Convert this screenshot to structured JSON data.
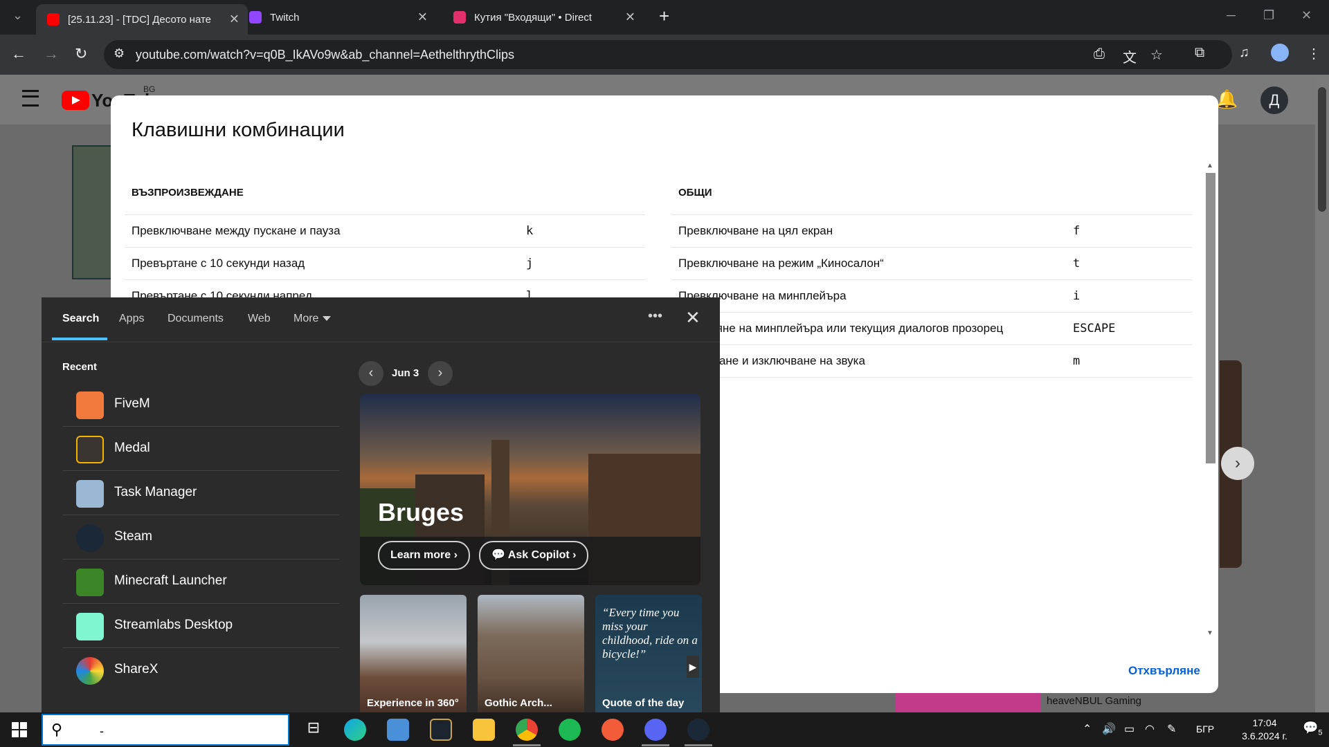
{
  "browser": {
    "tabs": [
      {
        "title": "[25.11.23] - [TDC] Десото нате",
        "color": "#ff0000"
      },
      {
        "title": "Twitch",
        "color": "#9146ff"
      },
      {
        "title": "Кутия \"Входящи\" • Direct",
        "color": "#e1306c"
      }
    ],
    "new_tab": "+",
    "url": "youtube.com/watch?v=q0B_IkAVo9w&ab_channel=AethelthrythClips"
  },
  "youtube": {
    "logo_text": "YouTube",
    "region": "BG",
    "avatar_letter": "Д",
    "channel_name": "heaveNBUL Gaming"
  },
  "shortcuts": {
    "title": "Клавишни комбинации",
    "playback": {
      "heading": "ВЪЗПРОИЗВЕЖДАНЕ",
      "rows": [
        {
          "label": "Превключване между пускане и пауза",
          "key": "k"
        },
        {
          "label": "Превъртане с 10 секунди назад",
          "key": "j"
        },
        {
          "label": "Превъртане с 10 секунди напред",
          "key": "l"
        }
      ]
    },
    "general": {
      "heading": "ОБЩИ",
      "rows": [
        {
          "label": "Превключване на цял екран",
          "key": "f"
        },
        {
          "label": "Превключване на режим „Киносалон“",
          "key": "t"
        },
        {
          "label": "Превключване на минплейъра",
          "key": "i"
        },
        {
          "label": "Затваряне на минплейъра или текущия диалогов прозорец",
          "key": "ESCAPE"
        },
        {
          "label": "Включване и изключване на звука",
          "key": "m"
        }
      ]
    },
    "dismiss": "Отхвърляне"
  },
  "windows_search": {
    "tabs": [
      "Search",
      "Apps",
      "Documents",
      "Web",
      "More"
    ],
    "recent_label": "Recent",
    "recent_apps": [
      {
        "name": "FiveM",
        "color": "#f0793b"
      },
      {
        "name": "Medal",
        "color": "#f5b400"
      },
      {
        "name": "Task Manager",
        "color": "#9ab7d3"
      },
      {
        "name": "Steam",
        "color": "#1b2838"
      },
      {
        "name": "Minecraft Launcher",
        "color": "#3c8527"
      },
      {
        "name": "Streamlabs Desktop",
        "color": "#80f5d2"
      },
      {
        "name": "ShareX",
        "color": "#2d8cf0"
      }
    ],
    "highlight": {
      "date": "Jun 3",
      "title": "Bruges",
      "learn_more": "Learn more",
      "ask_copilot": "Ask Copilot"
    },
    "cards": [
      {
        "caption": "Experience in 360°"
      },
      {
        "caption": "Gothic Arch..."
      },
      {
        "quote": "“Every time you miss your childhood, ride on a bicycle!”",
        "caption": "Quote of the day"
      }
    ]
  },
  "taskbar": {
    "search_value": "-",
    "language": "БГР",
    "time": "17:04",
    "date": "3.6.2024 г.",
    "notifications": "5"
  }
}
